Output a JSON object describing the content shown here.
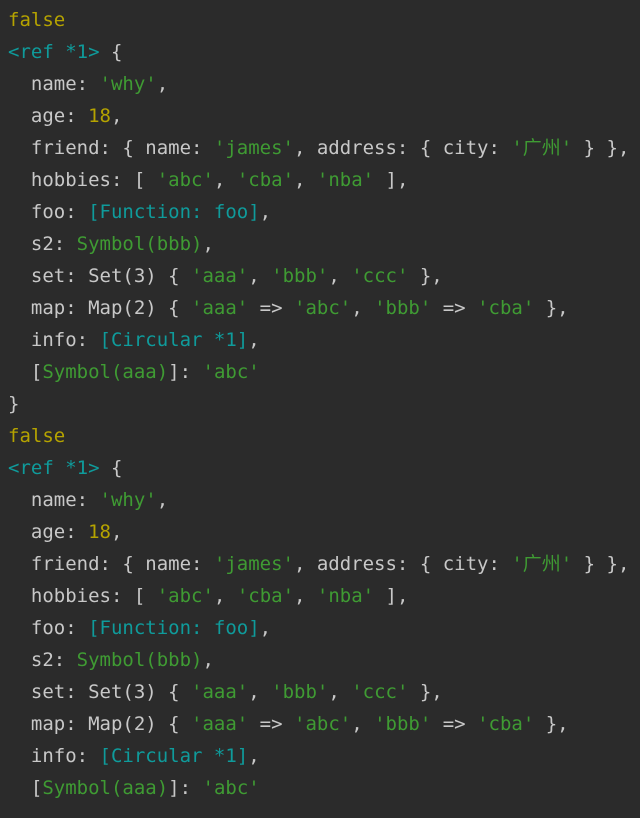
{
  "terminal": {
    "title": "node-console-output",
    "background_color": "#2b2b2b",
    "colors": {
      "plain": "#c8c8c8",
      "boolean": "#b5a300",
      "number": "#b5a300",
      "string": "#3f9b33",
      "special": "#0f9b9b"
    },
    "lines": [
      {
        "id": "line-1",
        "tokens": [
          {
            "text": "false",
            "kind": "bool"
          }
        ]
      },
      {
        "id": "line-2",
        "tokens": [
          {
            "text": "<ref *1>",
            "kind": "cyan"
          },
          {
            "text": " {",
            "kind": "plain"
          }
        ]
      },
      {
        "id": "line-3",
        "tokens": [
          {
            "text": "  name: ",
            "kind": "plain"
          },
          {
            "text": "'why'",
            "kind": "string"
          },
          {
            "text": ",",
            "kind": "plain"
          }
        ]
      },
      {
        "id": "line-4",
        "tokens": [
          {
            "text": "  age: ",
            "kind": "plain"
          },
          {
            "text": "18",
            "kind": "num"
          },
          {
            "text": ",",
            "kind": "plain"
          }
        ]
      },
      {
        "id": "line-5",
        "tokens": [
          {
            "text": "  friend: { name: ",
            "kind": "plain"
          },
          {
            "text": "'james'",
            "kind": "string"
          },
          {
            "text": ", address: { city: ",
            "kind": "plain"
          },
          {
            "text": "'广州'",
            "kind": "string"
          },
          {
            "text": " } },",
            "kind": "plain"
          }
        ]
      },
      {
        "id": "line-6",
        "tokens": [
          {
            "text": "  hobbies: [ ",
            "kind": "plain"
          },
          {
            "text": "'abc'",
            "kind": "string"
          },
          {
            "text": ", ",
            "kind": "plain"
          },
          {
            "text": "'cba'",
            "kind": "string"
          },
          {
            "text": ", ",
            "kind": "plain"
          },
          {
            "text": "'nba'",
            "kind": "string"
          },
          {
            "text": " ],",
            "kind": "plain"
          }
        ]
      },
      {
        "id": "line-7",
        "tokens": [
          {
            "text": "  foo: ",
            "kind": "plain"
          },
          {
            "text": "[Function: foo]",
            "kind": "cyan"
          },
          {
            "text": ",",
            "kind": "plain"
          }
        ]
      },
      {
        "id": "line-8",
        "tokens": [
          {
            "text": "  s2: ",
            "kind": "plain"
          },
          {
            "text": "Symbol(bbb)",
            "kind": "string"
          },
          {
            "text": ",",
            "kind": "plain"
          }
        ]
      },
      {
        "id": "line-9",
        "tokens": [
          {
            "text": "  set: Set(3) { ",
            "kind": "plain"
          },
          {
            "text": "'aaa'",
            "kind": "string"
          },
          {
            "text": ", ",
            "kind": "plain"
          },
          {
            "text": "'bbb'",
            "kind": "string"
          },
          {
            "text": ", ",
            "kind": "plain"
          },
          {
            "text": "'ccc'",
            "kind": "string"
          },
          {
            "text": " },",
            "kind": "plain"
          }
        ]
      },
      {
        "id": "line-10",
        "tokens": [
          {
            "text": "  map: Map(2) { ",
            "kind": "plain"
          },
          {
            "text": "'aaa'",
            "kind": "string"
          },
          {
            "text": " => ",
            "kind": "plain"
          },
          {
            "text": "'abc'",
            "kind": "string"
          },
          {
            "text": ", ",
            "kind": "plain"
          },
          {
            "text": "'bbb'",
            "kind": "string"
          },
          {
            "text": " => ",
            "kind": "plain"
          },
          {
            "text": "'cba'",
            "kind": "string"
          },
          {
            "text": " },",
            "kind": "plain"
          }
        ]
      },
      {
        "id": "line-11",
        "tokens": [
          {
            "text": "  info: ",
            "kind": "plain"
          },
          {
            "text": "[Circular *1]",
            "kind": "cyan"
          },
          {
            "text": ",",
            "kind": "plain"
          }
        ]
      },
      {
        "id": "line-12",
        "tokens": [
          {
            "text": "  [",
            "kind": "plain"
          },
          {
            "text": "Symbol(aaa)",
            "kind": "string"
          },
          {
            "text": "]: ",
            "kind": "plain"
          },
          {
            "text": "'abc'",
            "kind": "string"
          }
        ]
      },
      {
        "id": "line-13",
        "tokens": [
          {
            "text": "}",
            "kind": "plain"
          }
        ]
      },
      {
        "id": "line-14",
        "tokens": [
          {
            "text": "false",
            "kind": "bool"
          }
        ]
      },
      {
        "id": "line-15",
        "tokens": [
          {
            "text": "<ref *1>",
            "kind": "cyan"
          },
          {
            "text": " {",
            "kind": "plain"
          }
        ]
      },
      {
        "id": "line-16",
        "tokens": [
          {
            "text": "  name: ",
            "kind": "plain"
          },
          {
            "text": "'why'",
            "kind": "string"
          },
          {
            "text": ",",
            "kind": "plain"
          }
        ]
      },
      {
        "id": "line-17",
        "tokens": [
          {
            "text": "  age: ",
            "kind": "plain"
          },
          {
            "text": "18",
            "kind": "num"
          },
          {
            "text": ",",
            "kind": "plain"
          }
        ]
      },
      {
        "id": "line-18",
        "tokens": [
          {
            "text": "  friend: { name: ",
            "kind": "plain"
          },
          {
            "text": "'james'",
            "kind": "string"
          },
          {
            "text": ", address: { city: ",
            "kind": "plain"
          },
          {
            "text": "'广州'",
            "kind": "string"
          },
          {
            "text": " } },",
            "kind": "plain"
          }
        ]
      },
      {
        "id": "line-19",
        "tokens": [
          {
            "text": "  hobbies: [ ",
            "kind": "plain"
          },
          {
            "text": "'abc'",
            "kind": "string"
          },
          {
            "text": ", ",
            "kind": "plain"
          },
          {
            "text": "'cba'",
            "kind": "string"
          },
          {
            "text": ", ",
            "kind": "plain"
          },
          {
            "text": "'nba'",
            "kind": "string"
          },
          {
            "text": " ],",
            "kind": "plain"
          }
        ]
      },
      {
        "id": "line-20",
        "tokens": [
          {
            "text": "  foo: ",
            "kind": "plain"
          },
          {
            "text": "[Function: foo]",
            "kind": "cyan"
          },
          {
            "text": ",",
            "kind": "plain"
          }
        ]
      },
      {
        "id": "line-21",
        "tokens": [
          {
            "text": "  s2: ",
            "kind": "plain"
          },
          {
            "text": "Symbol(bbb)",
            "kind": "string"
          },
          {
            "text": ",",
            "kind": "plain"
          }
        ]
      },
      {
        "id": "line-22",
        "tokens": [
          {
            "text": "  set: Set(3) { ",
            "kind": "plain"
          },
          {
            "text": "'aaa'",
            "kind": "string"
          },
          {
            "text": ", ",
            "kind": "plain"
          },
          {
            "text": "'bbb'",
            "kind": "string"
          },
          {
            "text": ", ",
            "kind": "plain"
          },
          {
            "text": "'ccc'",
            "kind": "string"
          },
          {
            "text": " },",
            "kind": "plain"
          }
        ]
      },
      {
        "id": "line-23",
        "tokens": [
          {
            "text": "  map: Map(2) { ",
            "kind": "plain"
          },
          {
            "text": "'aaa'",
            "kind": "string"
          },
          {
            "text": " => ",
            "kind": "plain"
          },
          {
            "text": "'abc'",
            "kind": "string"
          },
          {
            "text": ", ",
            "kind": "plain"
          },
          {
            "text": "'bbb'",
            "kind": "string"
          },
          {
            "text": " => ",
            "kind": "plain"
          },
          {
            "text": "'cba'",
            "kind": "string"
          },
          {
            "text": " },",
            "kind": "plain"
          }
        ]
      },
      {
        "id": "line-24",
        "tokens": [
          {
            "text": "  info: ",
            "kind": "plain"
          },
          {
            "text": "[Circular *1]",
            "kind": "cyan"
          },
          {
            "text": ",",
            "kind": "plain"
          }
        ]
      },
      {
        "id": "line-25",
        "tokens": [
          {
            "text": "  [",
            "kind": "plain"
          },
          {
            "text": "Symbol(aaa)",
            "kind": "string"
          },
          {
            "text": "]: ",
            "kind": "plain"
          },
          {
            "text": "'abc'",
            "kind": "string"
          }
        ]
      }
    ]
  }
}
